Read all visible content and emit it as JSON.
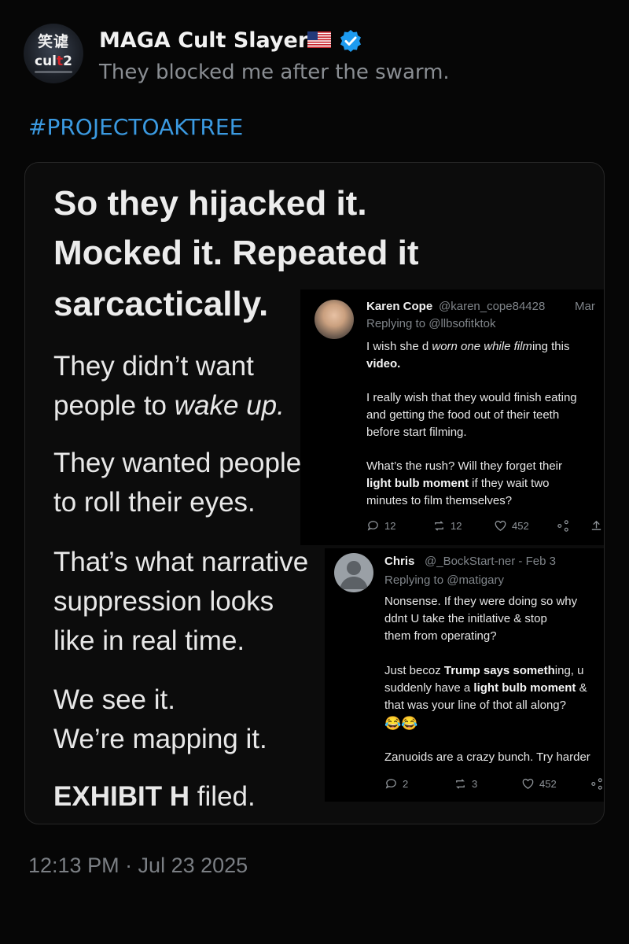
{
  "header": {
    "avatar_text_top": "笑谑",
    "avatar_text_bottom_a": "cul",
    "avatar_text_bottom_b": "t",
    "avatar_text_bottom_c": "2",
    "display_name": "MAGA Cult Slayer",
    "flag_icon": "us-flag-icon",
    "verified_icon": "verified-badge-icon",
    "subtitle": "They blocked me after the swarm."
  },
  "hashtag": "#PROJECTOAKTREE",
  "card": {
    "headline_lines": [
      "So they hijacked it.",
      "Mocked it. Repeated it",
      "sarcactically."
    ],
    "para1_a": "They didn’t want",
    "para1_b_pre": "people to ",
    "para1_b_em": "wake up.",
    "para2_lines": [
      "They wanted people",
      "to roll their eyes."
    ],
    "para3_lines": [
      "That’s what narrative",
      "suppression looks",
      "like in real time."
    ],
    "para4_lines": [
      "We see it.",
      "We’re mapping it."
    ],
    "exhibit_bold": "EXHIBIT H",
    "exhibit_rest": " filed."
  },
  "reply1": {
    "name": "Karen Cope",
    "handle": "@karen_cope84428",
    "date": "Mar",
    "replying": "Replying to @llbsofitktok",
    "l1_a": "I wish she d ",
    "l1_b": "worn one while film",
    "l1_c": "ing this",
    "l2": "video.",
    "l3": "I really wish that they would finish eating",
    "l4": "and getting the food out of their teeth",
    "l5": "before start filming.",
    "l6": "What’s the rush? Will they forget their",
    "l7_b": "light bulb moment",
    "l7_c": " if they wait two",
    "l8": "minutes to film themselves?",
    "replies": "12",
    "reposts": "12",
    "likes": "452"
  },
  "reply2": {
    "name": "Chris",
    "handle": "@_BockStart-ner - Feb 3",
    "replying": "Replying to @matigary",
    "l1": "Nonsense. If they were doing so why",
    "l2": "ddnt U take the initlative & stop",
    "l3": "them from operating?",
    "l4_a": "Just becoz ",
    "l4_b": "Trump says someth",
    "l4_c": "ing, u",
    "l5_a": "suddenly have a ",
    "l5_b": "light bulb moment",
    "l5_c": " &",
    "l6": "that was your line of thot all along?",
    "emoji": "😂😂",
    "l7": "Zanuoids are a crazy bunch. Try harder",
    "replies": "2",
    "reposts": "3",
    "likes": "452"
  },
  "timestamp": "12:13 PM · Jul 23 2025",
  "colors": {
    "background": "#060606",
    "hashtag": "#3b9ae1",
    "verified": "#1d9bf0",
    "muted": "#8a8e93"
  }
}
